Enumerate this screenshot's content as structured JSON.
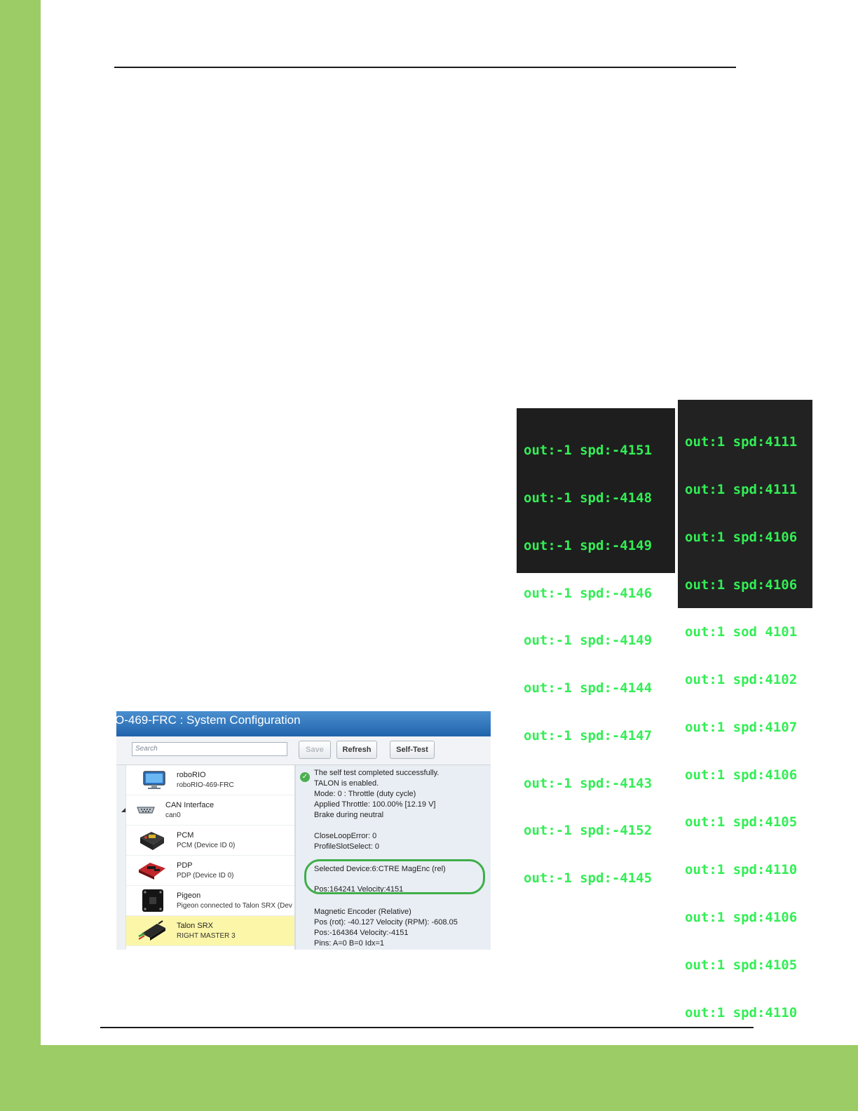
{
  "terminal_left": {
    "lines": [
      "out:-1 spd:-4151",
      "out:-1 spd:-4148",
      "out:-1 spd:-4149",
      "out:-1 spd:-4146",
      "out:-1 spd:-4149",
      "out:-1 spd:-4144",
      "out:-1 spd:-4147",
      "out:-1 spd:-4143",
      "out:-1 spd:-4152",
      "out:-1 spd:-4145"
    ]
  },
  "terminal_right": {
    "lines": [
      "out:1 spd:4111",
      "out:1 spd:4111",
      "out:1 spd:4106",
      "out:1 spd:4106",
      "out:1 sod 4101",
      "out:1 spd:4102",
      "out:1 spd:4107",
      "out:1 spd:4106",
      "out:1 spd:4105",
      "out:1 spd:4110",
      "out:1 spd:4106",
      "out:1 spd:4105",
      "out:1 spd:4110"
    ]
  },
  "screenshot": {
    "title": "O-469-FRC : System Configuration",
    "search_placeholder": "Search",
    "buttons": {
      "save": "Save",
      "refresh": "Refresh",
      "self_test": "Self-Test"
    },
    "devices": [
      {
        "name": "roboRIO",
        "detail": "roboRIO-469-FRC",
        "icon": "monitor-icon"
      },
      {
        "name": "CAN Interface",
        "detail": "can0",
        "icon": "serial-port-icon"
      },
      {
        "name": "PCM",
        "detail": "PCM (Device ID 0)",
        "icon": "pcm-icon"
      },
      {
        "name": "PDP",
        "detail": "PDP (Device ID 0)",
        "icon": "pdp-icon"
      },
      {
        "name": "Pigeon",
        "detail": "Pigeon connected to Talon SRX (Dev",
        "icon": "pigeon-icon"
      },
      {
        "name": "Talon SRX",
        "detail": "RIGHT MASTER 3",
        "icon": "talon-icon"
      }
    ],
    "info_lines": {
      "self_test": "The self test completed successfully.",
      "enabled": "TALON is enabled.",
      "mode": "Mode: 0 : Throttle (duty cycle)",
      "throttle": "Applied Throttle:  100.00% [12.19 V]",
      "brake": "Brake during neutral",
      "close_loop_error": "CloseLoopError: 0",
      "profile_slot": "ProfileSlotSelect: 0",
      "selected_device": "Selected Device:6:CTRE MagEnc (rel)",
      "pos_velocity": "Pos:164241   Velocity:4151",
      "mag_header": "Magnetic Encoder (Relative)",
      "mag_rot": "Pos (rot):  -40.127 Velocity (RPM): -608.05",
      "mag_pos": "Pos:-164364  Velocity:-4151",
      "pins": "Pins: A=0 B=0 Idx=1"
    },
    "colors": {
      "title_bar": "#2f78c0",
      "selected_row": "#fcf6a9",
      "highlight_ring": "#3fae4a",
      "terminal_text": "#33ee55"
    }
  }
}
